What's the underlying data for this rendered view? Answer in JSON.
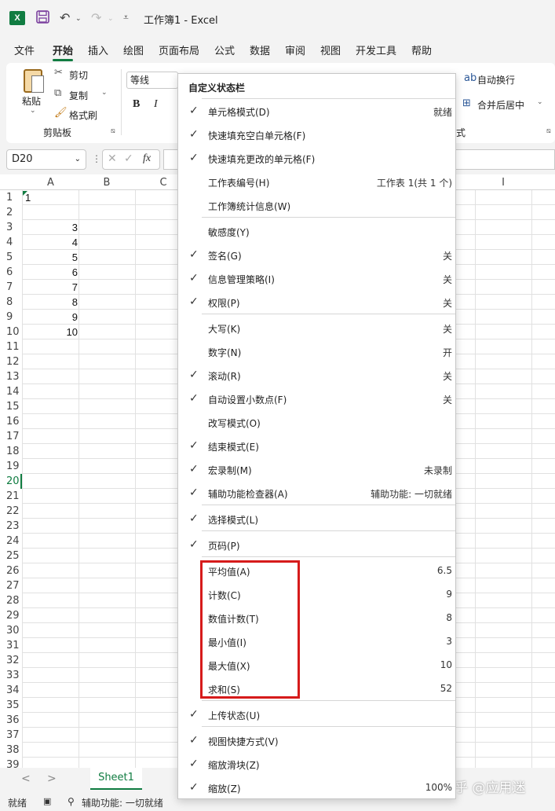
{
  "app": {
    "window_title": "工作簿1  -  Excel",
    "logo_letter": "X"
  },
  "menu_tabs": [
    "文件",
    "开始",
    "插入",
    "绘图",
    "页面布局",
    "公式",
    "数据",
    "审阅",
    "视图",
    "开发工具",
    "帮助"
  ],
  "ribbon": {
    "paste": "粘贴",
    "cut": "剪切",
    "copy": "复制",
    "format_painter": "格式刷",
    "clipboard_group": "剪贴板",
    "font_name": "等线",
    "bold": "B",
    "italic": "I",
    "wrap_text": "自动换行",
    "merge_center": "合并后居中",
    "align_group_tail": "式"
  },
  "formula_bar": {
    "name_box": "D20",
    "fx": "fx"
  },
  "grid": {
    "columns": [
      "A",
      "B",
      "C",
      "I"
    ],
    "rows": [
      "1",
      "2",
      "3",
      "4",
      "5",
      "6",
      "7",
      "8",
      "9",
      "10",
      "11",
      "12",
      "13",
      "14",
      "15",
      "16",
      "17",
      "18",
      "19",
      "20",
      "21",
      "22",
      "23",
      "24",
      "25",
      "26",
      "27",
      "28",
      "29",
      "30",
      "31",
      "32",
      "33",
      "34",
      "35",
      "36",
      "37",
      "38",
      "39"
    ],
    "selected_row": "20",
    "cells_A": [
      "1",
      "",
      "3",
      "4",
      "5",
      "6",
      "7",
      "8",
      "9",
      "10"
    ]
  },
  "sheet_tabs": {
    "active": "Sheet1",
    "prev": "<",
    "next": ">"
  },
  "status_bar": {
    "ready": "就绪",
    "accessibility": "辅助功能: 一切就绪"
  },
  "watermark": "知乎 @应用迷",
  "context_menu": {
    "title": "自定义状态栏",
    "items": [
      {
        "label": "单元格模式(D)",
        "checked": true,
        "value": "就绪"
      },
      {
        "label": "快速填充空白单元格(F)",
        "checked": true,
        "value": ""
      },
      {
        "label": "快速填充更改的单元格(F)",
        "checked": true,
        "value": ""
      },
      {
        "label": "工作表编号(H)",
        "checked": false,
        "value": "工作表 1(共 1 个)"
      },
      {
        "label": "工作簿统计信息(W)",
        "checked": false,
        "value": ""
      },
      {
        "label": "敏感度(Y)",
        "checked": false,
        "value": ""
      },
      {
        "label": "签名(G)",
        "checked": true,
        "value": "关"
      },
      {
        "label": "信息管理策略(I)",
        "checked": true,
        "value": "关"
      },
      {
        "label": "权限(P)",
        "checked": true,
        "value": "关"
      },
      {
        "label": "大写(K)",
        "checked": false,
        "value": "关"
      },
      {
        "label": "数字(N)",
        "checked": false,
        "value": "开"
      },
      {
        "label": "滚动(R)",
        "checked": true,
        "value": "关"
      },
      {
        "label": "自动设置小数点(F)",
        "checked": true,
        "value": "关"
      },
      {
        "label": "改写模式(O)",
        "checked": false,
        "value": ""
      },
      {
        "label": "结束模式(E)",
        "checked": true,
        "value": ""
      },
      {
        "label": "宏录制(M)",
        "checked": true,
        "value": "未录制"
      },
      {
        "label": "辅助功能检查器(A)",
        "checked": true,
        "value": "辅助功能: 一切就绪"
      },
      {
        "label": "选择模式(L)",
        "checked": true,
        "value": ""
      },
      {
        "label": "页码(P)",
        "checked": true,
        "value": ""
      },
      {
        "label": "平均值(A)",
        "checked": false,
        "value": "6.5"
      },
      {
        "label": "计数(C)",
        "checked": false,
        "value": "9"
      },
      {
        "label": "数值计数(T)",
        "checked": false,
        "value": "8"
      },
      {
        "label": "最小值(I)",
        "checked": false,
        "value": "3"
      },
      {
        "label": "最大值(X)",
        "checked": false,
        "value": "10"
      },
      {
        "label": "求和(S)",
        "checked": false,
        "value": "52"
      },
      {
        "label": "上传状态(U)",
        "checked": true,
        "value": ""
      },
      {
        "label": "视图快捷方式(V)",
        "checked": true,
        "value": ""
      },
      {
        "label": "缩放滑块(Z)",
        "checked": true,
        "value": ""
      },
      {
        "label": "缩放(Z)",
        "checked": true,
        "value": "100%"
      }
    ]
  }
}
